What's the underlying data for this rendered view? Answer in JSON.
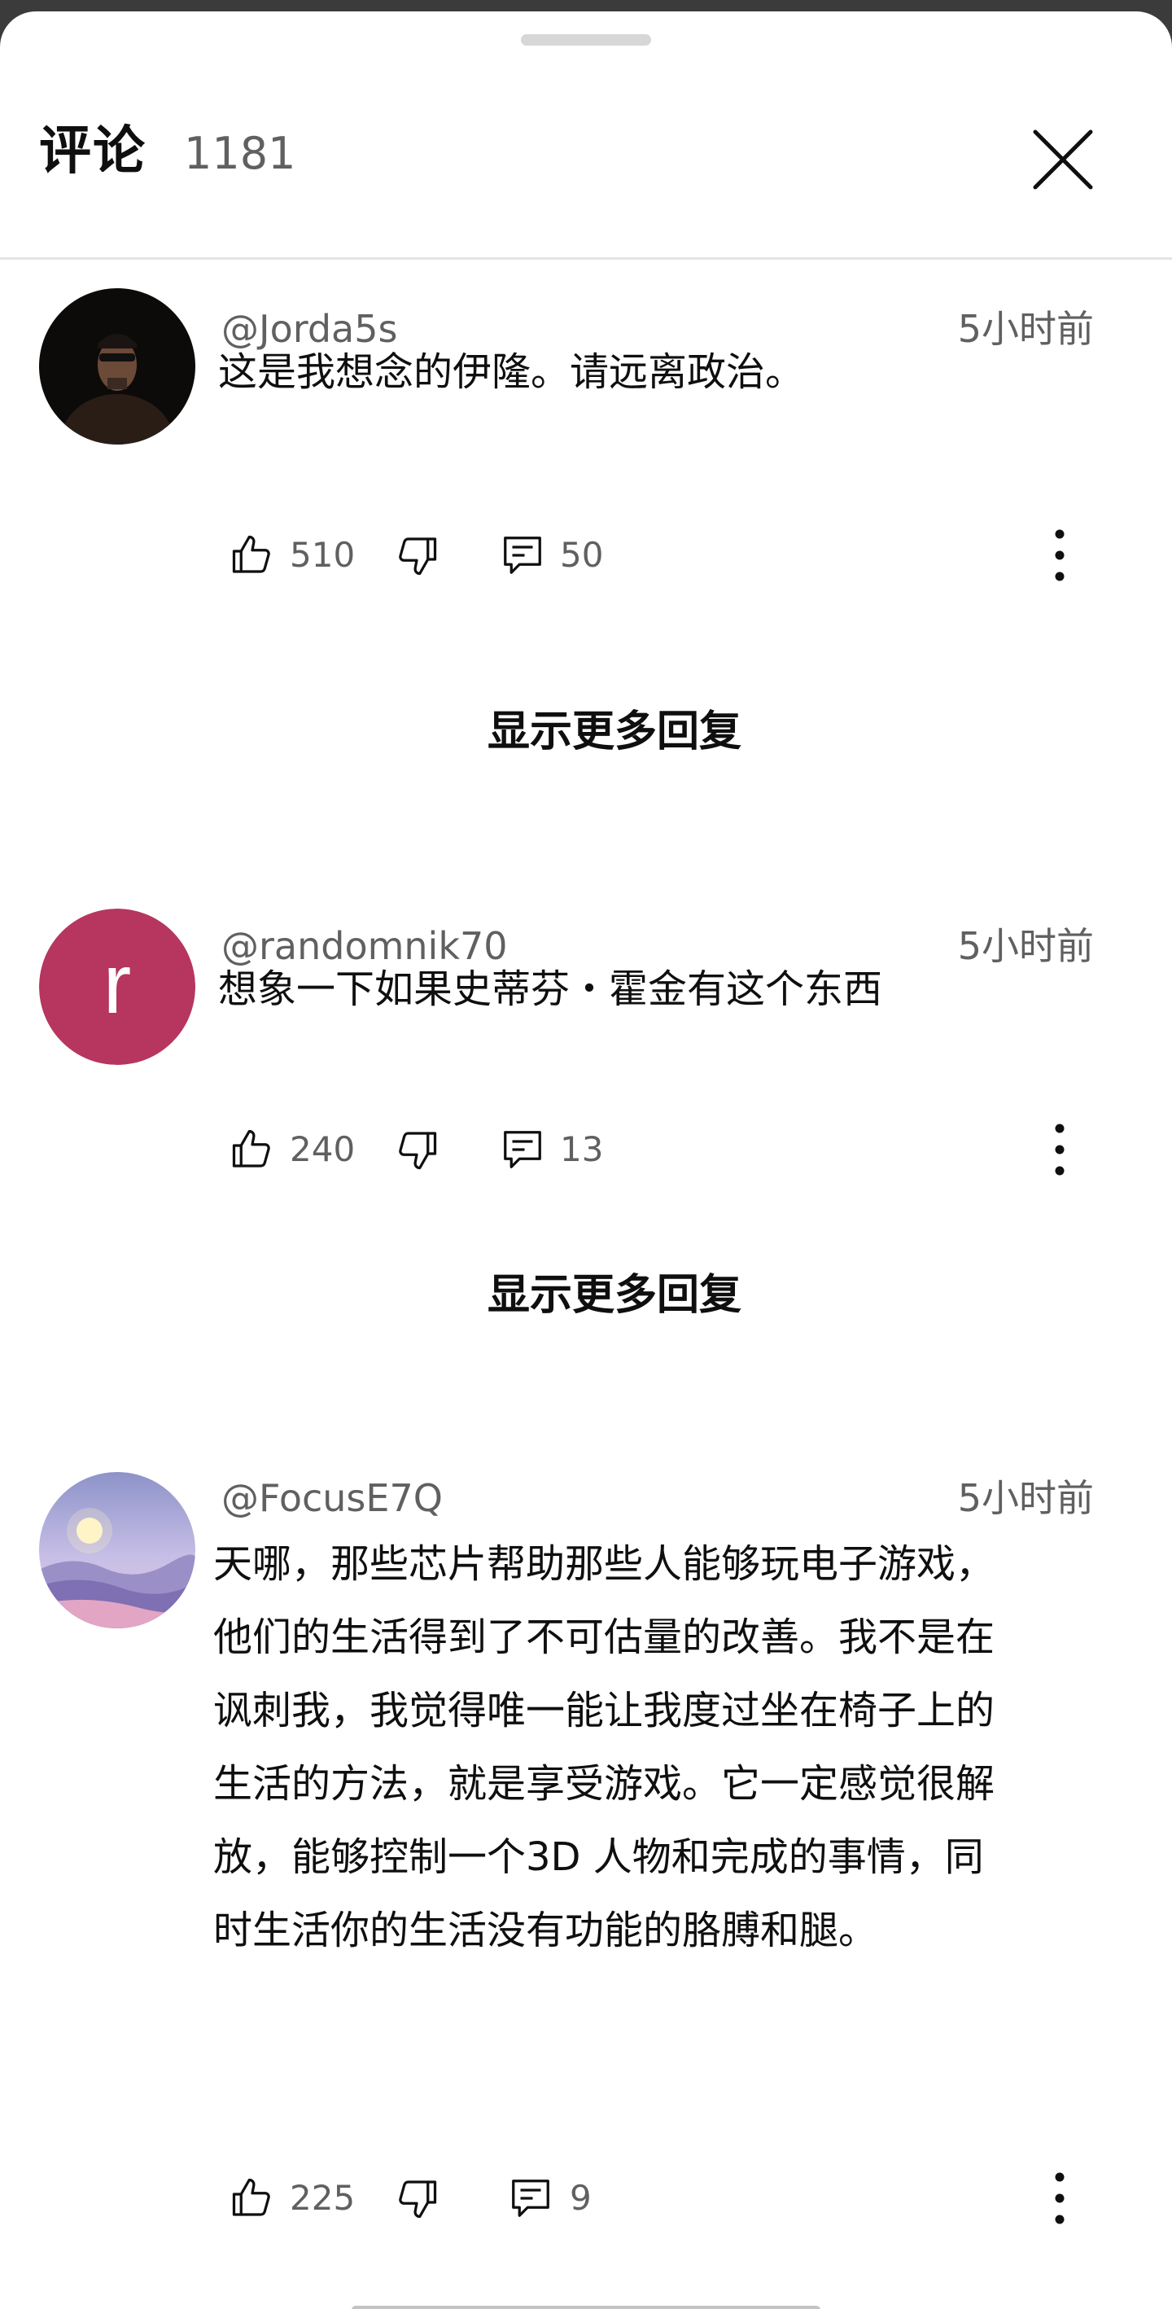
{
  "header": {
    "title": "评论",
    "count": "1181"
  },
  "comments": [
    {
      "handle": "@Jorda5s",
      "time": "5小时前",
      "text_lines": [
        "这是我想念的伊隆。请远离政治。"
      ],
      "likes": "510",
      "replies": "50",
      "avatar_icon": "person-photo"
    },
    {
      "handle": "@randomnik70",
      "time": "5小时前",
      "text_lines": [
        "想象一下如果史蒂芬・霍金有这个东西"
      ],
      "likes": "240",
      "replies": "13",
      "avatar_letter": "r",
      "avatar_color": "#b6365f"
    },
    {
      "handle": "@FocusE7Q",
      "time": "5小时前",
      "text_lines": [
        "天哪，那些芯片帮助那些人能够玩电子游戏，",
        "他们的生活得到了不可估量的改善。我不是在",
        "讽刺我，我觉得唯一能让我度过坐在椅子上的",
        "生活的方法，就是享受游戏。它一定感觉很解",
        "放，能够控制一个3D 人物和完成的事情，同",
        "时生活你的生活没有功能的胳膊和腿。"
      ],
      "likes": "225",
      "replies": "9",
      "avatar_icon": "landscape-image"
    }
  ],
  "show_more_label": "显示更多回复",
  "icons": {
    "close": "close-icon",
    "like": "thumbs-up-icon",
    "dislike": "thumbs-down-icon",
    "reply": "reply-icon",
    "more": "more-vert-icon"
  },
  "colors": {
    "text_primary": "#0f0f0f",
    "text_secondary": "#606060",
    "avatar_r": "#b6365f"
  }
}
